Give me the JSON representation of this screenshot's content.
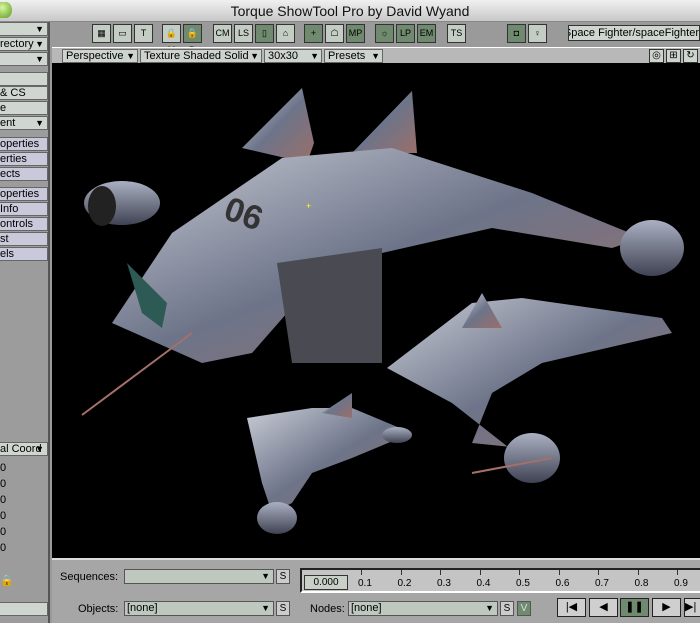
{
  "window": {
    "title": "Torque ShowTool Pro by David Wyand"
  },
  "sidebar": {
    "rows": [
      {
        "label": "",
        "arrow": "▼"
      },
      {
        "label": "rectory",
        "arrow": "▼"
      },
      {
        "label": "",
        "arrow": "▼"
      },
      {
        "label": ""
      },
      {
        "label": "& CS"
      },
      {
        "label": "e"
      },
      {
        "label": "ent",
        "arrow": "▼"
      },
      {
        "label": "operties"
      },
      {
        "label": "erties"
      },
      {
        "label": "ects"
      },
      {
        "label": "operties"
      },
      {
        "label": "Info"
      },
      {
        "label": "ontrols"
      },
      {
        "label": "st"
      },
      {
        "label": "els"
      }
    ],
    "coord_dropdown": "al Coord",
    "values": [
      "0",
      "0",
      "0",
      "0",
      "0",
      "0"
    ]
  },
  "toolbar": {
    "buttons": [
      {
        "icon": "grid-icon",
        "label": "▦"
      },
      {
        "icon": "monitor-icon",
        "label": "▭"
      },
      {
        "icon": "text-toilet-icon",
        "label": "T"
      },
      {
        "icon": "lock-m-icon",
        "label": "🔒M"
      },
      {
        "icon": "lock-d-icon",
        "label": "🔒D",
        "active": true
      },
      {
        "icon": "cm-icon",
        "label": "CM"
      },
      {
        "icon": "los-icon",
        "label": "LS"
      },
      {
        "icon": "box-icon",
        "label": "▯",
        "active": true
      },
      {
        "icon": "frame-icon",
        "label": "⌂"
      },
      {
        "icon": "plus-icon",
        "label": "+",
        "active": true
      },
      {
        "icon": "ghost-icon",
        "label": "☖"
      },
      {
        "icon": "mp-icon",
        "label": "MP",
        "active": true
      },
      {
        "icon": "light-icon",
        "label": "☼",
        "active": true
      },
      {
        "icon": "light-p-icon",
        "label": "LP",
        "active": true
      },
      {
        "icon": "em-icon",
        "label": "EM",
        "active": true
      },
      {
        "icon": "ts-icon",
        "label": "TS"
      },
      {
        "icon": "camera-cursor-icon",
        "label": "◘",
        "active": true
      },
      {
        "icon": "light-cursor-icon",
        "label": "♀"
      }
    ],
    "path": "ts/Space Fighter/spaceFighter"
  },
  "viewbar": {
    "view": "Perspective",
    "shading": "Texture Shaded Solid",
    "grid": "30x30",
    "presets": "Presets",
    "icons": [
      "target-icon",
      "move-icon",
      "rotate-icon"
    ]
  },
  "bottom": {
    "sequences_label": "Sequences:",
    "sequences_value": "",
    "objects_label": "Objects:",
    "objects_value": "[none]",
    "nodes_label": "Nodes:",
    "nodes_value": "[none]",
    "s": "S",
    "v": "V",
    "time": "0.000",
    "ticks": [
      "0.1",
      "0.2",
      "0.3",
      "0.4",
      "0.5",
      "0.6",
      "0.7",
      "0.8",
      "0.9"
    ],
    "playback": [
      {
        "icon": "rewind-start-icon",
        "label": "|◀"
      },
      {
        "icon": "step-back-icon",
        "label": "◀"
      },
      {
        "icon": "pause-icon",
        "label": "❚❚",
        "active": true
      },
      {
        "icon": "play-icon",
        "label": "▶"
      },
      {
        "icon": "end-icon",
        "label": "▶|"
      }
    ]
  }
}
